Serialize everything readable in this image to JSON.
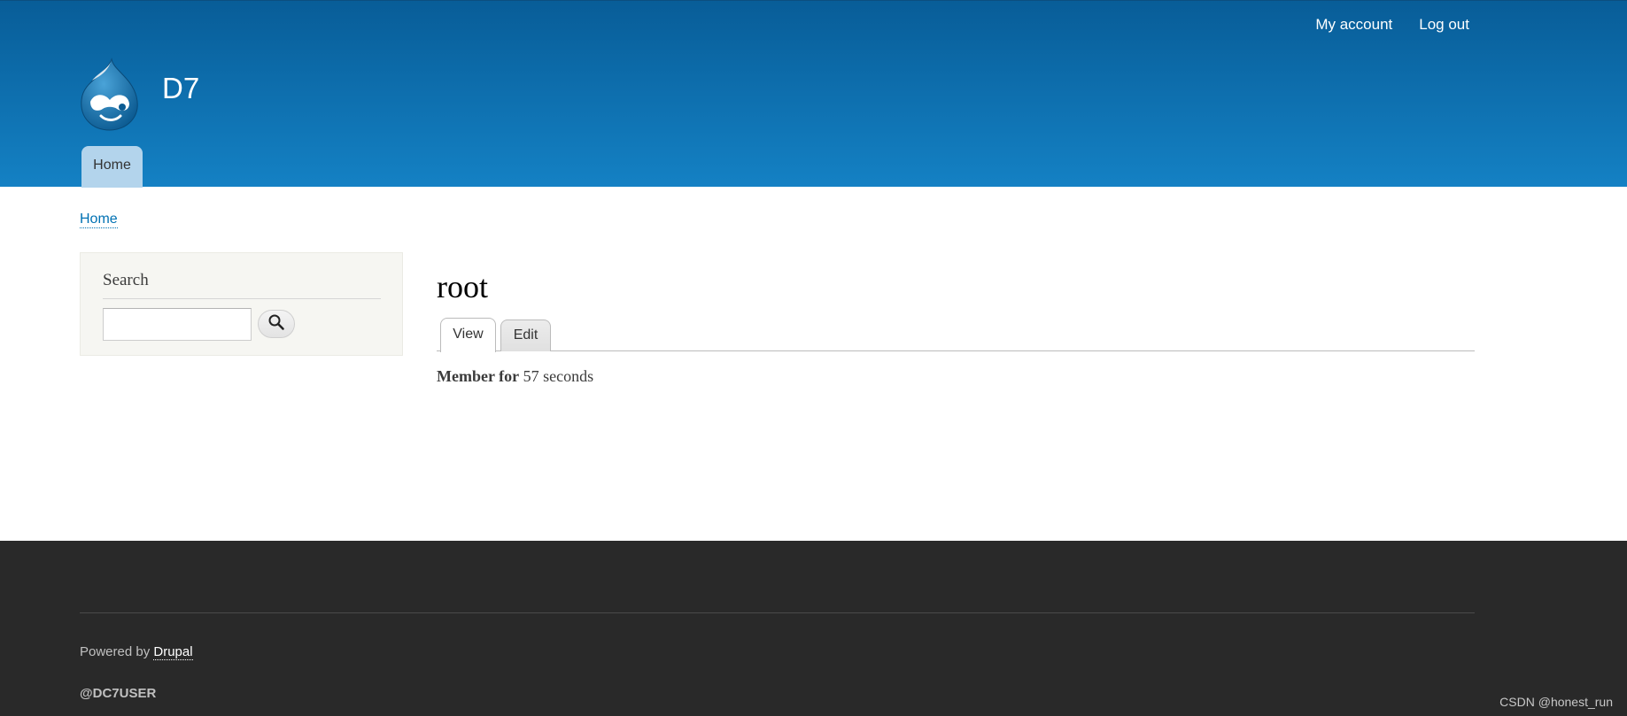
{
  "header": {
    "site_name": "D7",
    "secondary_menu": {
      "my_account": "My account",
      "log_out": "Log out"
    },
    "main_menu": {
      "home": "Home"
    }
  },
  "breadcrumb": {
    "home": "Home"
  },
  "sidebar": {
    "search_title": "Search",
    "search_value": "",
    "search_button_icon": "search-icon"
  },
  "main": {
    "title": "root",
    "tabs": [
      {
        "label": "View",
        "active": true
      },
      {
        "label": "Edit",
        "active": false
      }
    ],
    "member_label": "Member for",
    "member_value": " 57 seconds"
  },
  "footer": {
    "powered_prefix": "Powered by ",
    "powered_link": "Drupal",
    "user_tag": "@DC7USER"
  },
  "watermark": "CSDN @honest_run",
  "colors": {
    "header_top": "#085d98",
    "header_bottom": "#1481c4",
    "menu_tab": "#b3d4ec",
    "link": "#0071b3",
    "footer_bg": "#292929"
  }
}
